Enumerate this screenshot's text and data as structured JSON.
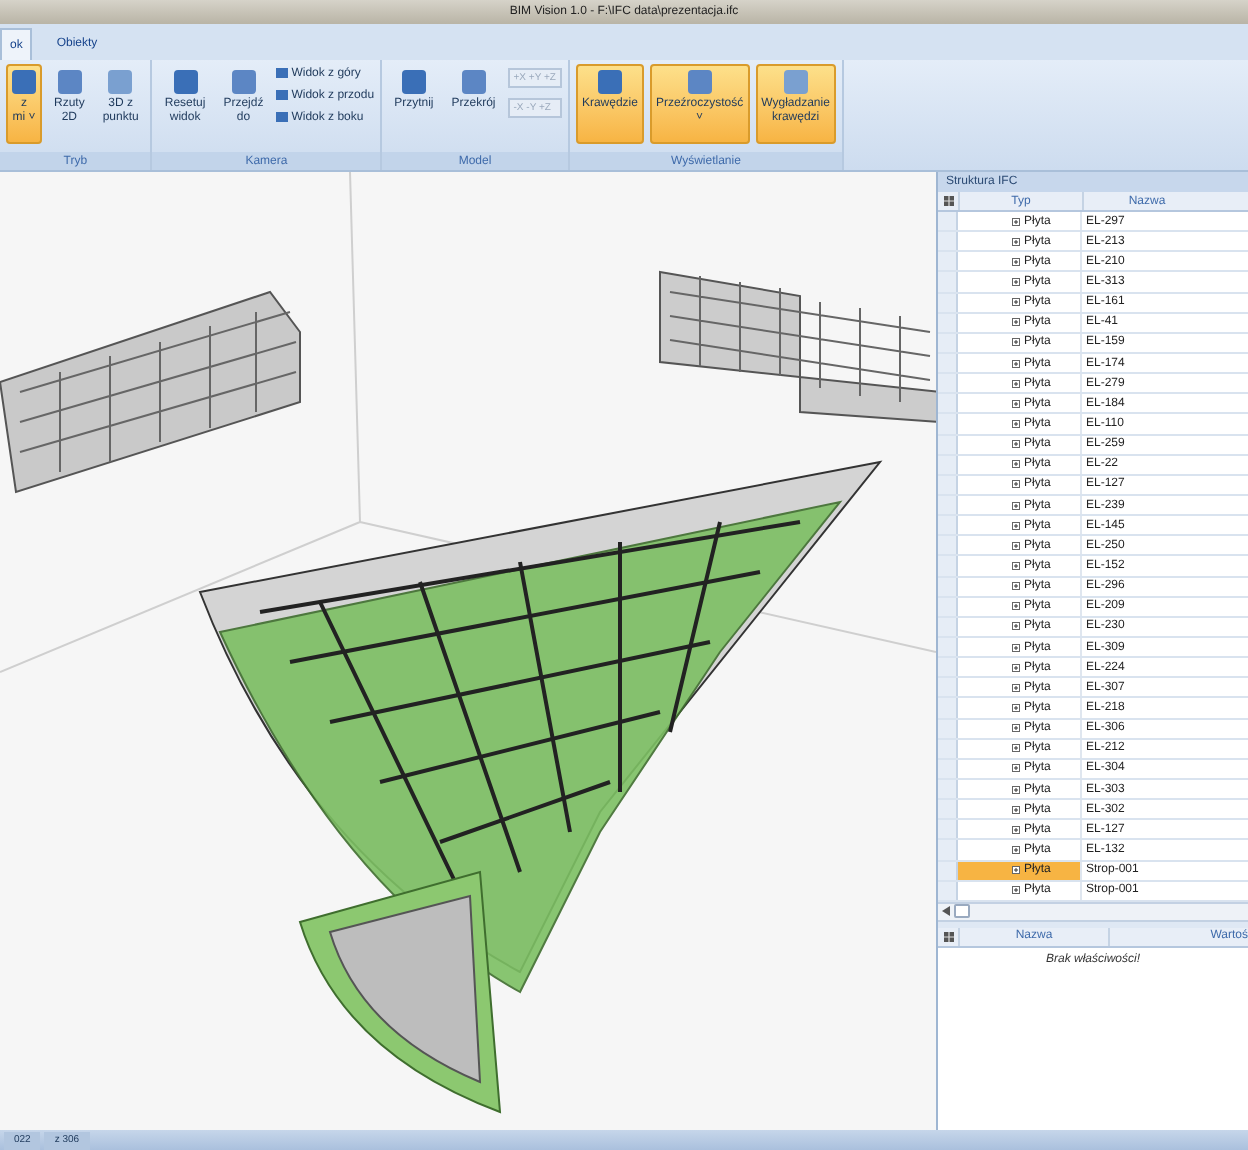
{
  "window": {
    "title": "BIM Vision 1.0 - F:\\IFC data\\prezentacja.ifc"
  },
  "tabs": [
    {
      "label": "ok",
      "selected": true
    },
    {
      "label": "Obiekty",
      "selected": false
    }
  ],
  "ribbon": [
    {
      "label": "Tryb",
      "items": [
        {
          "kind": "large",
          "lines": [
            "z",
            "mi ˅"
          ],
          "selected": true
        },
        {
          "kind": "large",
          "lines": [
            "Rzuty",
            "2D"
          ],
          "selected": false
        },
        {
          "kind": "large",
          "lines": [
            "3D z",
            "punktu"
          ],
          "selected": false
        }
      ]
    },
    {
      "label": "Kamera",
      "items": [
        {
          "kind": "large",
          "lines": [
            "Resetuj",
            "widok"
          ],
          "selected": false
        },
        {
          "kind": "large",
          "lines": [
            "Przejdź",
            "do"
          ],
          "selected": false
        },
        {
          "kind": "small",
          "lines": [
            "Widok z góry",
            "Widok z przodu",
            "Widok z boku"
          ],
          "selected": false
        }
      ]
    },
    {
      "label": "Model",
      "items": [
        {
          "kind": "large",
          "lines": [
            "Przytnij"
          ],
          "selected": false
        },
        {
          "kind": "large",
          "lines": [
            "Przekrój"
          ],
          "selected": false
        },
        {
          "kind": "fields",
          "lines": [
            "+X +Y +Z",
            "-X -Y +Z"
          ],
          "selected": false
        }
      ]
    },
    {
      "label": "Wyświetlanie",
      "items": [
        {
          "kind": "large",
          "lines": [
            "Krawędzie"
          ],
          "selected": true
        },
        {
          "kind": "large",
          "lines": [
            "Przeźroczystość",
            "˅"
          ],
          "selected": true
        },
        {
          "kind": "large",
          "lines": [
            "Wygładzanie",
            "krawędzi"
          ],
          "selected": true
        }
      ]
    }
  ],
  "structure_panel": {
    "title": "Struktura IFC",
    "columns": [
      "Typ",
      "Nazwa"
    ],
    "rows": [
      {
        "type": "Płyta",
        "name": "EL-297",
        "selected": false
      },
      {
        "type": "Płyta",
        "name": "EL-213",
        "selected": false
      },
      {
        "type": "Płyta",
        "name": "EL-210",
        "selected": false
      },
      {
        "type": "Płyta",
        "name": "EL-313",
        "selected": false
      },
      {
        "type": "Płyta",
        "name": "EL-161",
        "selected": false
      },
      {
        "type": "Płyta",
        "name": "EL-41",
        "selected": false
      },
      {
        "type": "Płyta",
        "name": "EL-159",
        "selected": false
      },
      {
        "type": "Płyta",
        "name": "EL-174",
        "selected": false
      },
      {
        "type": "Płyta",
        "name": "EL-279",
        "selected": false
      },
      {
        "type": "Płyta",
        "name": "EL-184",
        "selected": false
      },
      {
        "type": "Płyta",
        "name": "EL-110",
        "selected": false
      },
      {
        "type": "Płyta",
        "name": "EL-259",
        "selected": false
      },
      {
        "type": "Płyta",
        "name": "EL-22",
        "selected": false
      },
      {
        "type": "Płyta",
        "name": "EL-127",
        "selected": false
      },
      {
        "type": "Płyta",
        "name": "EL-239",
        "selected": false
      },
      {
        "type": "Płyta",
        "name": "EL-145",
        "selected": false
      },
      {
        "type": "Płyta",
        "name": "EL-250",
        "selected": false
      },
      {
        "type": "Płyta",
        "name": "EL-152",
        "selected": false
      },
      {
        "type": "Płyta",
        "name": "EL-296",
        "selected": false
      },
      {
        "type": "Płyta",
        "name": "EL-209",
        "selected": false
      },
      {
        "type": "Płyta",
        "name": "EL-230",
        "selected": false
      },
      {
        "type": "Płyta",
        "name": "EL-309",
        "selected": false
      },
      {
        "type": "Płyta",
        "name": "EL-224",
        "selected": false
      },
      {
        "type": "Płyta",
        "name": "EL-307",
        "selected": false
      },
      {
        "type": "Płyta",
        "name": "EL-218",
        "selected": false
      },
      {
        "type": "Płyta",
        "name": "EL-306",
        "selected": false
      },
      {
        "type": "Płyta",
        "name": "EL-212",
        "selected": false
      },
      {
        "type": "Płyta",
        "name": "EL-304",
        "selected": false
      },
      {
        "type": "Płyta",
        "name": "EL-303",
        "selected": false
      },
      {
        "type": "Płyta",
        "name": "EL-302",
        "selected": false
      },
      {
        "type": "Płyta",
        "name": "EL-127",
        "selected": false
      },
      {
        "type": "Płyta",
        "name": "EL-132",
        "selected": false
      },
      {
        "type": "Płyta",
        "name": "Strop-001",
        "selected": true
      },
      {
        "type": "Płyta",
        "name": "Strop-001",
        "selected": false
      }
    ]
  },
  "properties_panel": {
    "columns": [
      "Nazwa",
      "Wartoś"
    ],
    "message": "Brak właściwości!"
  },
  "status_bar": [
    "022",
    "z 306"
  ]
}
